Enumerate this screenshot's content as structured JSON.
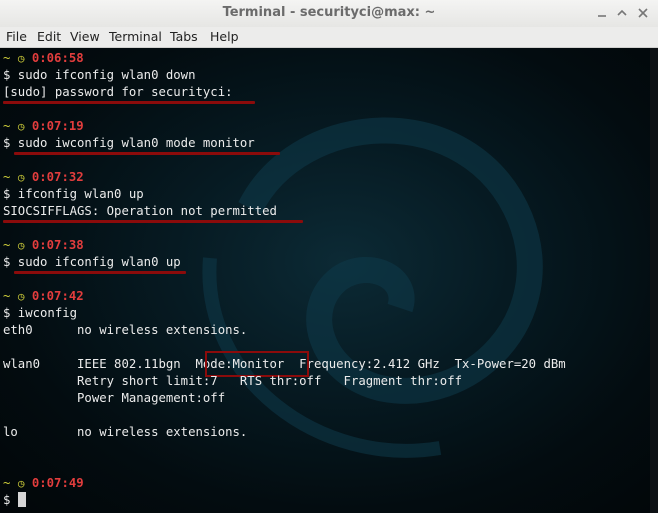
{
  "window": {
    "title": "Terminal - securityci@max: ~",
    "controls": [
      "minimize-icon",
      "maximize-icon",
      "close-icon"
    ]
  },
  "menu": [
    "File",
    "Edit",
    "View",
    "Terminal",
    "Tabs",
    "Help"
  ],
  "colors": {
    "prompt_tilde": "#cfcf3a",
    "timestamp": "#e23d3d",
    "highlight": "#8b0b0b",
    "text": "#ececec"
  },
  "terminal": {
    "prompt_char": "~",
    "clock_icon": "clock-icon",
    "blocks": [
      {
        "time": "0:06:58",
        "lines": [
          "$ sudo ifconfig wlan0 down",
          "[sudo] password for securityci:"
        ]
      },
      {
        "time": "0:07:19",
        "lines": [
          "$ sudo iwconfig wlan0 mode monitor"
        ]
      },
      {
        "time": "0:07:32",
        "lines": [
          "$ ifconfig wlan0 up",
          "SIOCSIFFLAGS: Operation not permitted"
        ]
      },
      {
        "time": "0:07:38",
        "lines": [
          "$ sudo ifconfig wlan0 up"
        ]
      },
      {
        "time": "0:07:42",
        "lines": [
          "$ iwconfig"
        ]
      }
    ],
    "iwconfig": {
      "eth0": "eth0      no wireless extensions.",
      "wlan0_pre": "wlan0     IEEE 802.11bgn  ",
      "wlan0_mode": "Mode:Monitor",
      "wlan0_post": "  Frequency:2.412 GHz  Tx-Power=20 dBm",
      "retry": "          Retry short limit:7   RTS thr:off   Fragment thr:off",
      "power": "          Power Management:off",
      "lo": "lo        no wireless extensions."
    },
    "last_time": "0:07:49",
    "last_prompt": "$ "
  }
}
